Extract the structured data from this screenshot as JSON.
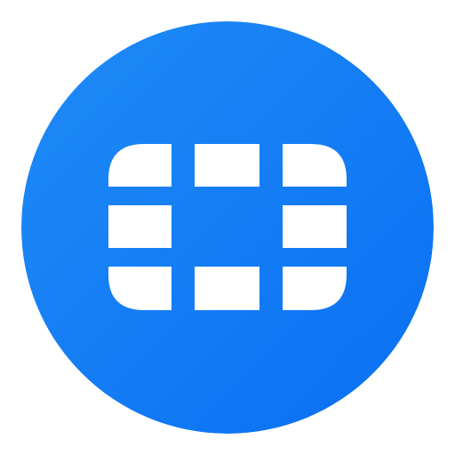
{
  "icon": {
    "name": "fortinet-logo-icon",
    "background_color_start": "#1f8bf7",
    "background_color_end": "#0a6ff2",
    "glyph_color": "#ffffff"
  }
}
